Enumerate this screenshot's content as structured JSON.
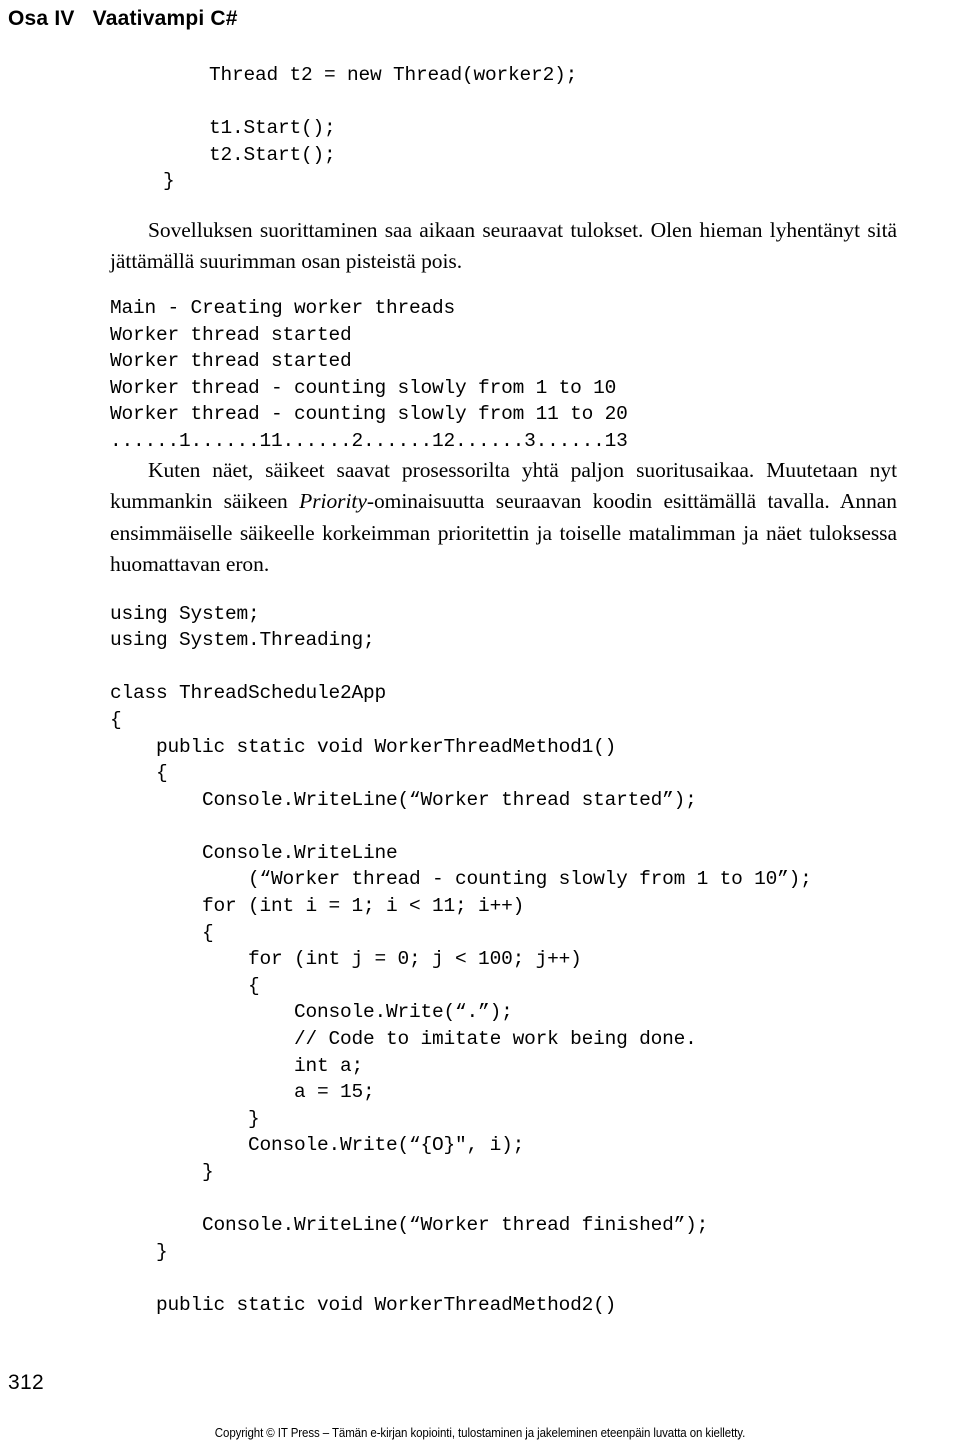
{
  "running_head": "Osa IV   Vaativampi C#",
  "code_top": "    Thread t2 = new Thread(worker2);\n\n    t1.Start();\n    t2.Start();\n}",
  "paragraph_1": {
    "text": "Sovelluksen suorittaminen saa aikaan seuraavat tulokset. Olen hieman lyhentänyt sitä jättämällä suurimman osan pisteistä pois."
  },
  "code_output": "Main - Creating worker threads\nWorker thread started\nWorker thread started\nWorker thread - counting slowly from 1 to 10\nWorker thread - counting slowly from 11 to 20\n......1......11......2......12......3......13",
  "paragraph_2": {
    "before_italic": "Kuten näet, säikeet saavat prosessorilta yhtä paljon suoritusaikaa. Muutetaan nyt kummankin säikeen ",
    "italic": "Priority",
    "after_italic": "-ominaisuutta seuraavan koodin esittämällä tavalla. Annan ensimmäiselle säikeelle korkeimman prioritettin ja toiselle matalimman ja näet tuloksessa huomattavan eron."
  },
  "code_main": "using System;\nusing System.Threading;\n\nclass ThreadSchedule2App\n{\n    public static void WorkerThreadMethod1()\n    {\n        Console.WriteLine(“Worker thread started”);\n\n        Console.WriteLine\n            (“Worker thread - counting slowly from 1 to 10”);\n        for (int i = 1; i < 11; i++)\n        {\n            for (int j = 0; j < 100; j++)\n            {\n                Console.Write(“.”);\n                // Code to imitate work being done.\n                int a;\n                a = 15;\n            }\n            Console.Write(“{O}\", i);\n        }\n\n        Console.WriteLine(“Worker thread finished”);\n    }\n\n    public static void WorkerThreadMethod2()",
  "footer": {
    "page_number": "312",
    "copyright": "Copyright © IT Press – Tämän e-kirjan kopiointi, tulostaminen ja jakeleminen eteenpäin luvatta on kielletty."
  }
}
